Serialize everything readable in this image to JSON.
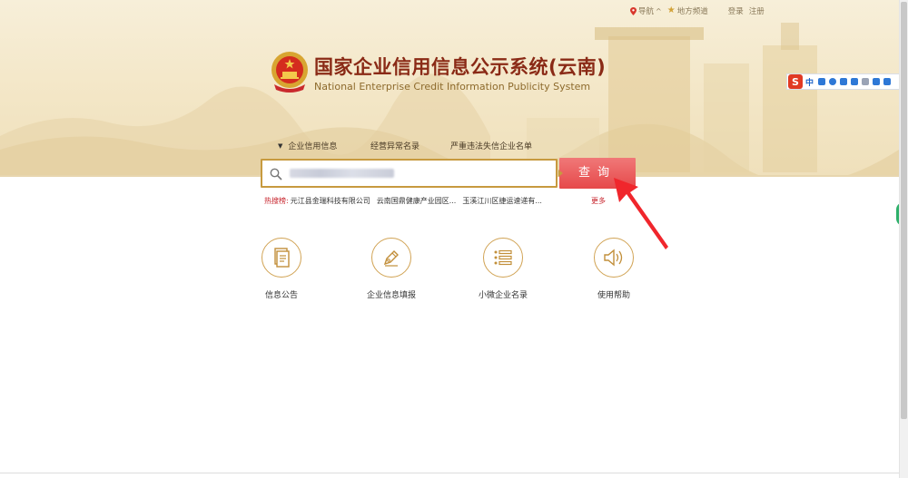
{
  "toplinks": {
    "nav_label": "导航",
    "local_label": "地方频道",
    "login_label": "登录",
    "register_label": "注册"
  },
  "header": {
    "title_cn": "国家企业信用信息公示系统(云南)",
    "title_en": "National Enterprise Credit Information Publicity System"
  },
  "tabs": [
    {
      "label": "企业信用信息"
    },
    {
      "label": "经营异常名录"
    },
    {
      "label": "严重违法失信企业名单"
    }
  ],
  "search": {
    "value": "",
    "button_label": "查询"
  },
  "hot": {
    "label": "热搜榜:",
    "items": [
      "元江县金瑞科技有限公司",
      "云南国鼎健康产业园区...",
      "玉溪江川区捷运速递有..."
    ],
    "more": "更多"
  },
  "quick_links": [
    {
      "label": "信息公告",
      "icon": "document-icon"
    },
    {
      "label": "企业信息填报",
      "icon": "pen-icon"
    },
    {
      "label": "小微企业名录",
      "icon": "list-icon"
    },
    {
      "label": "使用帮助",
      "icon": "speaker-icon"
    }
  ],
  "ime": {
    "logo": "S",
    "mode": "中"
  },
  "colors": {
    "accent_red": "#e6494a",
    "gold": "#c79a3f",
    "title": "#8a2a16"
  }
}
